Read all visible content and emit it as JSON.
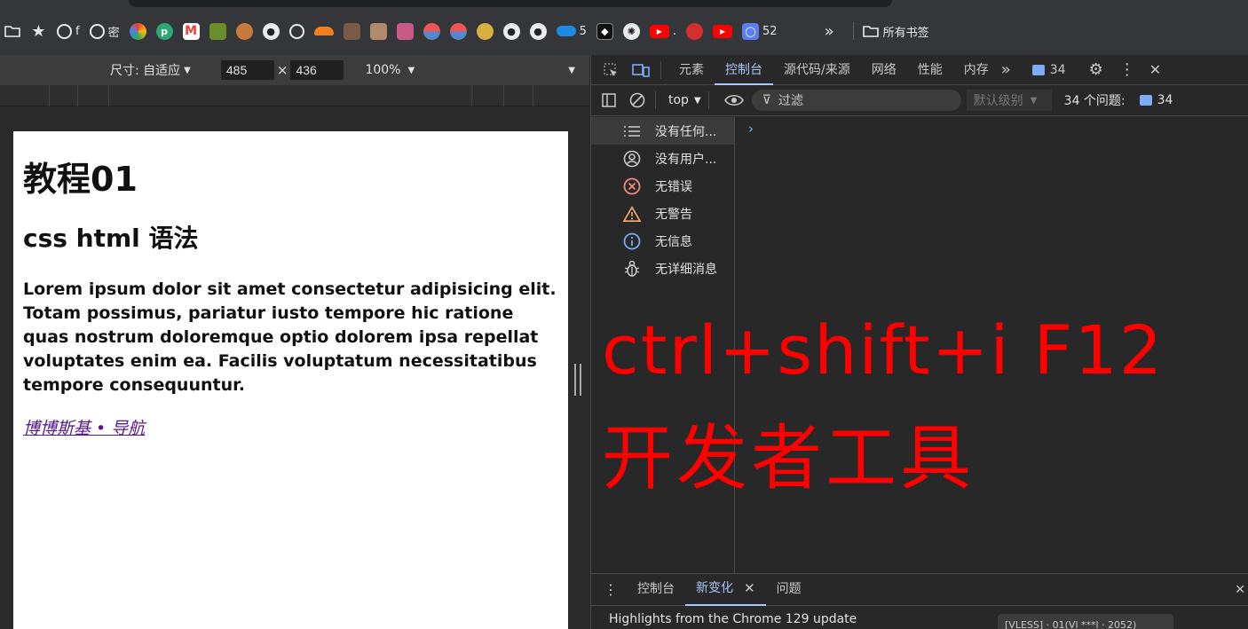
{
  "bookmarks": {
    "items": [
      {
        "icon": "folder-icon",
        "label": ""
      },
      {
        "icon": "star-icon",
        "label": ""
      },
      {
        "icon": "globe-icon",
        "label": "f"
      },
      {
        "icon": "globe-icon",
        "label": "密"
      },
      {
        "icon": "pinwheel-icon",
        "label": ""
      },
      {
        "icon": "pushbullet-icon",
        "label": ""
      },
      {
        "icon": "gmail-icon",
        "label": ""
      },
      {
        "icon": "game-icon",
        "label": ""
      },
      {
        "icon": "food-icon",
        "label": ""
      },
      {
        "icon": "github-icon",
        "label": ""
      },
      {
        "icon": "globe-icon",
        "label": ""
      },
      {
        "icon": "cloudflare-icon",
        "label": ""
      },
      {
        "icon": "avatar-icon",
        "label": ""
      },
      {
        "icon": "avatar-icon",
        "label": ""
      },
      {
        "icon": "avatar-icon",
        "label": ""
      },
      {
        "icon": "disc-icon",
        "label": ""
      },
      {
        "icon": "disc-icon",
        "label": ""
      },
      {
        "icon": "badge-icon",
        "label": ""
      },
      {
        "icon": "github-icon",
        "label": ""
      },
      {
        "icon": "github-icon",
        "label": ""
      },
      {
        "icon": "onedrive-icon",
        "label": "5"
      },
      {
        "icon": "tianjin-icon",
        "label": ""
      },
      {
        "icon": "openai-icon",
        "label": ""
      },
      {
        "icon": "youtube-icon",
        "label": "."
      },
      {
        "icon": "octopus-icon",
        "label": ""
      },
      {
        "icon": "youtube-icon",
        "label": ""
      },
      {
        "icon": "app-icon",
        "label": "52"
      }
    ],
    "overflow": "»",
    "all_bookmarks": "所有书签"
  },
  "device_toolbar": {
    "dimensions_label": "尺寸: 自适应",
    "width": "485",
    "height": "436",
    "times": "×",
    "zoom": "100%"
  },
  "page": {
    "h1": "教程01",
    "h2": "css html 语法",
    "paragraph": "Lorem ipsum dolor sit amet consectetur adipisicing elit. Totam possimus, pariatur iusto tempore hic ratione quas nostrum doloremque optio dolorem ipsa repellat voluptates enim ea. Facilis voluptatum necessitatibus tempore consequuntur.",
    "link": "博博斯基 • 导航"
  },
  "devtools": {
    "tabs": [
      "元素",
      "控制台",
      "源代码/来源",
      "网络",
      "性能",
      "内存"
    ],
    "active_tab": "控制台",
    "issues_count": "34",
    "context": "top",
    "filter_placeholder": "过滤",
    "level": "默认级别",
    "issues_label": "34 个问题:",
    "issues_badge": "34",
    "sidebar": [
      {
        "icon": "list-icon",
        "label": "没有任何..."
      },
      {
        "icon": "user-icon",
        "label": "没有用户..."
      },
      {
        "icon": "error-icon",
        "label": "无错误"
      },
      {
        "icon": "warning-icon",
        "label": "无警告"
      },
      {
        "icon": "info-icon",
        "label": "无信息"
      },
      {
        "icon": "bug-icon",
        "label": "无详细消息"
      }
    ],
    "prompt": "›",
    "drawer_tabs": [
      "控制台",
      "新变化",
      "问题"
    ],
    "drawer_active": "新变化",
    "whatsnew_title": "Highlights from the Chrome 129 update",
    "whatsnew_card": "[VLESS] · 01(Vl ***l · 2052)",
    "colors": {
      "accent": "#a8c7fa",
      "error": "#f28b82",
      "warning": "#f9ab77",
      "info": "#7cacf8"
    }
  },
  "overlay": {
    "line1": "ctrl+shift+i    F12",
    "line2": "开发者工具",
    "color": "#ff0000"
  }
}
